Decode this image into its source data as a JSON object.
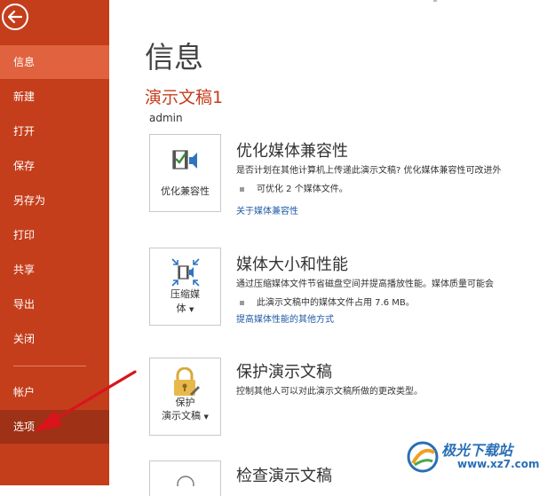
{
  "sidebar": {
    "items": [
      {
        "label": "信息"
      },
      {
        "label": "新建"
      },
      {
        "label": "打开"
      },
      {
        "label": "保存"
      },
      {
        "label": "另存为"
      },
      {
        "label": "打印"
      },
      {
        "label": "共享"
      },
      {
        "label": "导出"
      },
      {
        "label": "关闭"
      },
      {
        "label": "帐户"
      },
      {
        "label": "选项"
      }
    ]
  },
  "main": {
    "title": "信息",
    "doc_title": "演示文稿1",
    "author": "admin",
    "sections": [
      {
        "tile_label_1": "优化兼容性",
        "tile_label_2": "",
        "title": "优化媒体兼容性",
        "desc": "是否计划在其他计算机上传递此演示文稿? 优化媒体兼容性可改进外",
        "bullet": "可优化 2 个媒体文件。",
        "link": "关于媒体兼容性"
      },
      {
        "tile_label_1": "压缩媒",
        "tile_label_2": "体",
        "title": "媒体大小和性能",
        "desc": "通过压缩媒体文件节省磁盘空间并提高播放性能。媒体质量可能会",
        "bullet": "此演示文稿中的媒体文件占用 7.6 MB。",
        "link": "提高媒体性能的其他方式"
      },
      {
        "tile_label_1": "保护",
        "tile_label_2": "演示文稿",
        "title": "保护演示文稿",
        "desc": "控制其他人可以对此演示文稿所做的更改类型。"
      },
      {
        "title": "检查演示文稿"
      }
    ]
  },
  "watermark": {
    "name": "极光下载站",
    "url": "www.xz7.com"
  },
  "colors": {
    "sidebar": "#c43e1c",
    "active": "#e0623f",
    "link": "#1f5aa6",
    "arrow": "#d9141b"
  }
}
